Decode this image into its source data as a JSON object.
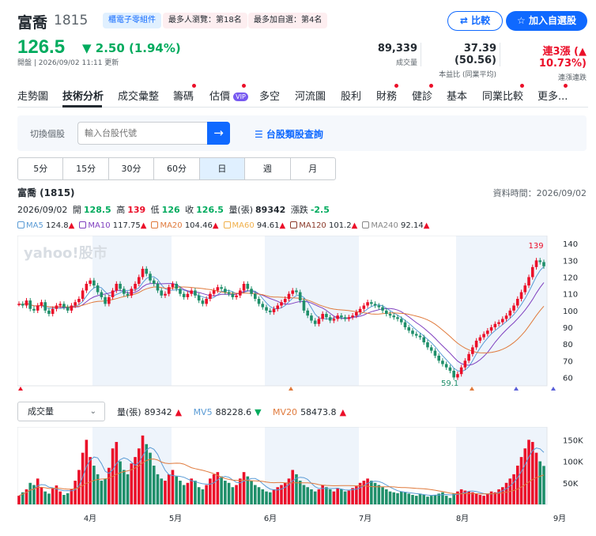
{
  "stock": {
    "name": "富喬",
    "code": "1815",
    "tags": [
      "櫃電子零組件",
      "最多人瀏覽：第18名",
      "最多加自選：第4名"
    ],
    "price": "126.5",
    "change": "▼ 2.50 (1.94%)",
    "updated": "開盤 | 2026/09/02 11:11 更新",
    "compare_label": "比較",
    "add_watch_label": "加入自選股"
  },
  "stats": [
    {
      "value": "89,339",
      "label": "成交量"
    },
    {
      "value": "37.39 (50.56)",
      "label": "本益比 (同業平均)"
    },
    {
      "value": "連3漲 (▲ 10.73%)",
      "label": "連漲連跌"
    }
  ],
  "tabs": [
    "走勢圖",
    "技術分析",
    "成交彙整",
    "籌碼",
    "估價",
    "多空",
    "河流圖",
    "股利",
    "財務",
    "健診",
    "基本",
    "同業比較",
    "更多..."
  ],
  "tab_badge": "VIP",
  "switcher": {
    "label": "切換個股",
    "placeholder": "輸入台股代號",
    "category_link": "☰ 台股類股查詢"
  },
  "periods": [
    "5分",
    "15分",
    "30分",
    "60分",
    "日",
    "週",
    "月"
  ],
  "chart_title": "富喬 (1815)",
  "data_time": "資料時間：2026/09/02",
  "ohlc": {
    "date": "2026/09/02",
    "open_label": "開",
    "open": "128.5",
    "high_label": "高",
    "high": "139",
    "low_label": "低",
    "low": "126",
    "close_label": "收",
    "close": "126.5",
    "vol_label": "量(張)",
    "vol": "89342",
    "chg_label": "漲跌",
    "chg": "-2.5"
  },
  "ma_legend": [
    {
      "name": "MA5",
      "value": "124.8",
      "color": "#5a9bd5"
    },
    {
      "name": "MA10",
      "value": "117.75",
      "color": "#7f3fbf"
    },
    {
      "name": "MA20",
      "value": "104.46",
      "color": "#e07a3c"
    },
    {
      "name": "MA60",
      "value": "94.61",
      "color": "#f0b04a"
    },
    {
      "name": "MA120",
      "value": "101.2",
      "color": "#8b3a2a"
    },
    {
      "name": "MA240",
      "value": "92.14",
      "color": "#888888"
    }
  ],
  "watermark": "yahoo!股市",
  "volume_selector": "成交量",
  "volume_legend": {
    "vol_label": "量(張)",
    "vol": "89342",
    "mv5_label": "MV5",
    "mv5": "88228.6",
    "mv20_label": "MV20",
    "mv20": "58473.8"
  },
  "colors": {
    "up": "#eb0f29",
    "down": "#00ab5e",
    "accent": "#0f69ff"
  },
  "chart_data": {
    "type": "candlestick",
    "price_axis_ticks": [
      140,
      130,
      120,
      110,
      100,
      90,
      80,
      70,
      60
    ],
    "price_ylim": [
      55,
      142
    ],
    "high_label": "139",
    "low_label": "59.1",
    "volume_axis_ticks": [
      "150K",
      "100K",
      "50K"
    ],
    "volume_ylim": [
      0,
      180000
    ],
    "month_labels": [
      "4月",
      "5月",
      "6月",
      "7月",
      "8月",
      "9月"
    ],
    "closes": [
      104,
      103,
      106,
      101,
      100,
      103,
      105,
      100,
      98,
      101,
      103,
      104,
      102,
      100,
      103,
      105,
      107,
      112,
      116,
      118,
      115,
      111,
      108,
      104,
      108,
      112,
      116,
      113,
      110,
      109,
      113,
      116,
      120,
      125,
      122,
      118,
      116,
      112,
      109,
      110,
      114,
      116,
      113,
      110,
      108,
      110,
      112,
      109,
      106,
      104,
      107,
      110,
      112,
      114,
      113,
      111,
      110,
      108,
      109,
      112,
      116,
      113,
      110,
      107,
      104,
      102,
      100,
      99,
      101,
      103,
      105,
      107,
      110,
      112,
      111,
      106,
      100,
      97,
      94,
      92,
      95,
      98,
      96,
      94,
      95,
      97,
      96,
      95,
      96,
      97,
      99,
      101,
      103,
      105,
      104,
      103,
      102,
      100,
      98,
      97,
      96,
      95,
      93,
      90,
      88,
      86,
      85,
      84,
      81,
      78,
      76,
      73,
      70,
      68,
      66,
      64,
      60,
      62,
      66,
      70,
      74,
      78,
      82,
      84,
      86,
      88,
      90,
      92,
      93,
      95,
      97,
      100,
      103,
      107,
      111,
      115,
      120,
      126,
      130,
      129,
      126.5
    ],
    "volume_k": [
      20,
      28,
      35,
      50,
      45,
      60,
      40,
      30,
      25,
      38,
      44,
      30,
      22,
      26,
      35,
      55,
      80,
      120,
      150,
      110,
      90,
      70,
      55,
      60,
      85,
      130,
      145,
      100,
      80,
      70,
      95,
      110,
      130,
      160,
      140,
      120,
      90,
      70,
      60,
      55,
      70,
      80,
      65,
      55,
      45,
      50,
      60,
      55,
      40,
      35,
      45,
      60,
      70,
      75,
      65,
      55,
      50,
      40,
      45,
      60,
      75,
      65,
      55,
      45,
      40,
      35,
      30,
      28,
      35,
      40,
      45,
      50,
      60,
      80,
      70,
      55,
      45,
      40,
      35,
      30,
      35,
      45,
      40,
      35,
      30,
      38,
      35,
      30,
      32,
      38,
      42,
      50,
      55,
      60,
      55,
      50,
      45,
      40,
      35,
      30,
      28,
      26,
      30,
      28,
      25,
      22,
      20,
      25,
      22,
      18,
      20,
      22,
      25,
      28,
      20,
      15,
      25,
      30,
      35,
      32,
      30,
      28,
      25,
      22,
      20,
      25,
      30,
      28,
      35,
      40,
      50,
      60,
      70,
      90,
      110,
      130,
      150,
      145,
      120,
      100,
      89.3
    ],
    "series": [
      {
        "name": "MA5"
      },
      {
        "name": "MA10"
      },
      {
        "name": "MA20"
      }
    ]
  }
}
